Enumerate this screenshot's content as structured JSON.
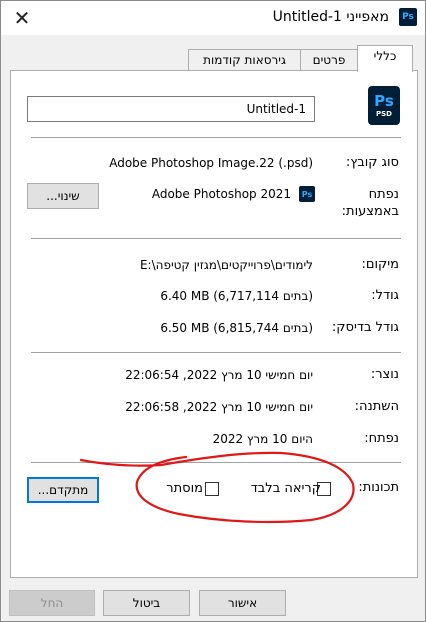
{
  "window": {
    "title": "מאפייני Untitled-1",
    "close_glyph": "✕",
    "app_icon": "Ps"
  },
  "tabs": [
    {
      "label": "כללי",
      "active": true
    },
    {
      "label": "פרטים",
      "active": false
    },
    {
      "label": "גירסאות קודמות",
      "active": false
    }
  ],
  "general": {
    "file_name": "Untitled-1",
    "icon": {
      "name": "photoshop-file-icon",
      "line1": "Ps",
      "line2": "PSD"
    },
    "file_type": {
      "label": "סוג קובץ:",
      "value": "Adobe Photoshop Image.22 (.psd)"
    },
    "opens_with": {
      "label_line1": "נפתח",
      "label_line2": "באמצעות:",
      "value": "Adobe Photoshop 2021",
      "change_button": "שינוי..."
    },
    "location": {
      "label": "מיקום:",
      "value": "E:\\לימודים\\פרוייקטים\\מגזין קטיפה"
    },
    "size": {
      "label": "גודל:",
      "value": "6.40 MB (6,717,114 בתים)"
    },
    "size_on_disk": {
      "label": "גודל בדיסק:",
      "value": "6.50 MB (6,815,744 בתים)"
    },
    "created": {
      "label": "נוצר:",
      "value": "יום חמישי 10 מרץ 2022, 22:06:54"
    },
    "modified": {
      "label": "השתנה:",
      "value": "יום חמישי 10 מרץ 2022, 22:06:58"
    },
    "accessed": {
      "label": "נפתח:",
      "value": "היום 10 מרץ 2022"
    },
    "attributes": {
      "label": "תכונות:",
      "readonly": "קריאה בלבד",
      "hidden": "מוסתר",
      "advanced_button": "מתקדם..."
    }
  },
  "footer": {
    "ok": "אישור",
    "cancel": "ביטול",
    "apply": "החל"
  },
  "colors": {
    "annotation": "#e01818",
    "accent": "#0078d7",
    "ps_bg": "#001e36",
    "ps_fg": "#31a8ff"
  }
}
